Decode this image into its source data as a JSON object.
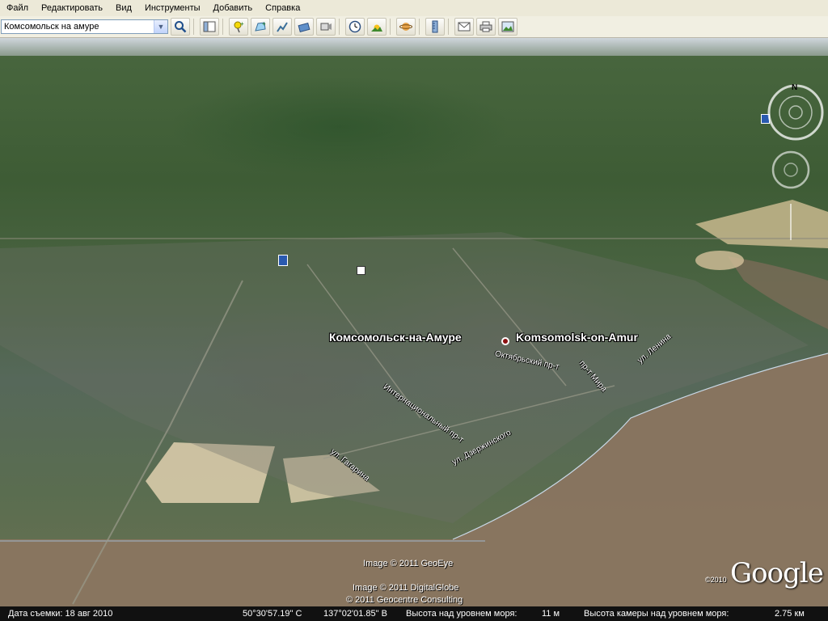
{
  "menu": {
    "items": [
      "Файл",
      "Редактировать",
      "Вид",
      "Инструменты",
      "Добавить",
      "Справка"
    ]
  },
  "toolbar": {
    "search_value": "Комсомольск на амуре"
  },
  "map": {
    "city_label_ru": "Комсомольск-на-Амуре",
    "city_label_en": "Komsomolsk-on-Amur",
    "streets": {
      "internationalny": "Интернациональный пр-т",
      "oktyabrsky": "Октябрьский пр-т",
      "mira": "пр-т Мира",
      "gagarina": "ул. Гагарина",
      "dzerzhinskogo": "ул. Дзержинского",
      "lenina": "ул. Ленина"
    },
    "compass_north": "N",
    "credits": {
      "geoeye": "Image © 2011 GeoEye",
      "digitalglobe": "Image © 2011 DigitalGlobe",
      "geocentre": "© 2011 Geocentre Consulting"
    },
    "google_year": "©2010",
    "google_logo": "Google"
  },
  "status": {
    "date_label": "Дата съемки: 18 авг 2010",
    "lat": "50°30'57.19\" С",
    "lon": "137°02'01.85\" В",
    "elevation_label": "Высота над уровнем моря:",
    "elevation_value": "11 м",
    "eye_label": "Высота камеры над уровнем моря:",
    "eye_value": "2.75 км"
  }
}
